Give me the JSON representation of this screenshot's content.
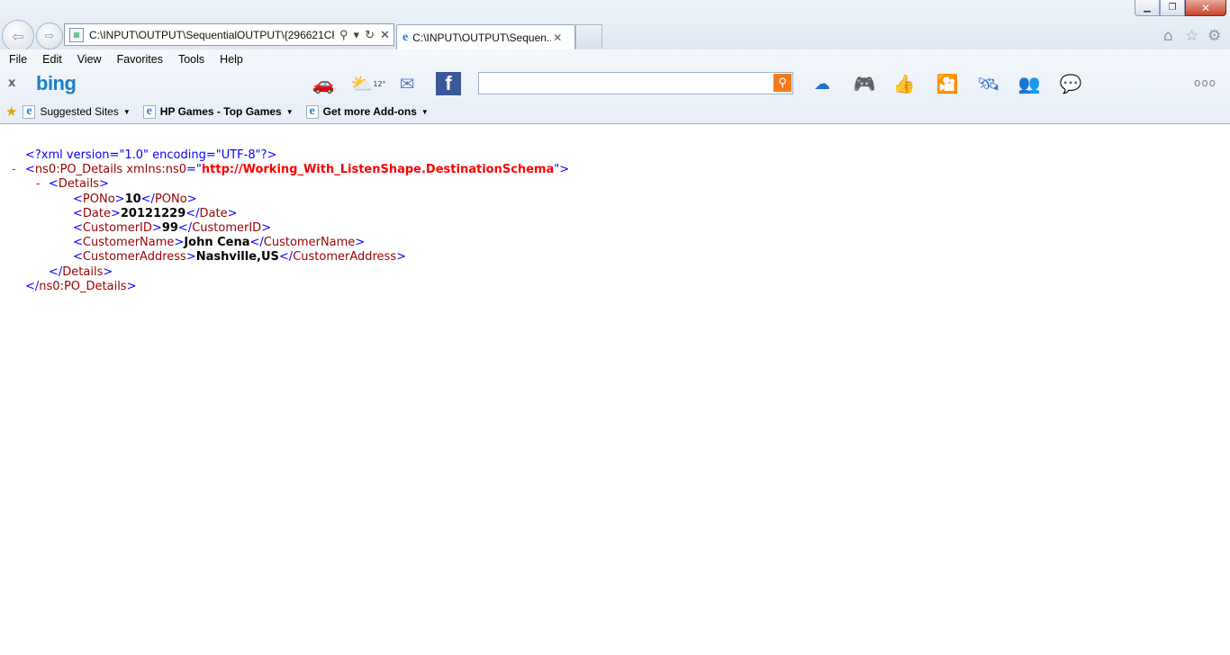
{
  "window": {
    "minimize": "▁",
    "restore": "❐",
    "close": "✕"
  },
  "navigation": {
    "back_icon": "arrow-left-icon",
    "forward_icon": "arrow-right-icon"
  },
  "address_bar": {
    "value": "C:\\INPUT\\OUTPUT\\SequentialOUTPUT\\{296621CF-"
  },
  "tab": {
    "title": "C:\\INPUT\\OUTPUT\\Sequen..."
  },
  "menu": [
    "File",
    "Edit",
    "View",
    "Favorites",
    "Tools",
    "Help"
  ],
  "bing_bar": {
    "close": "x",
    "logo": "bing",
    "weather_temp": "12°",
    "more": "ooo"
  },
  "favorites_bar": {
    "items": [
      {
        "label": "Suggested Sites"
      },
      {
        "label": "HP Games - Top Games"
      },
      {
        "label": "Get more Add-ons"
      }
    ]
  },
  "xml": {
    "declaration": "<?xml version=\"1.0\" encoding=\"UTF-8\"?>",
    "root_tag": "ns0:PO_Details",
    "root_attr_name": "xmlns:ns0",
    "root_attr_value": "http://Working_With_ListenShape.DestinationSchema",
    "details_tag": "Details",
    "fields": [
      {
        "tag": "PONo",
        "value": "10"
      },
      {
        "tag": "Date",
        "value": "20121229"
      },
      {
        "tag": "CustomerID",
        "value": "99"
      },
      {
        "tag": "CustomerName",
        "value": "John Cena"
      },
      {
        "tag": "CustomerAddress",
        "value": "Nashville,US"
      }
    ]
  },
  "colors": {
    "xml_markup": "#0000ff",
    "xml_tag": "#990000",
    "xml_attr_value": "#ff0000",
    "bing_blue": "#1d7fc4",
    "search_orange": "#f27b1d"
  }
}
